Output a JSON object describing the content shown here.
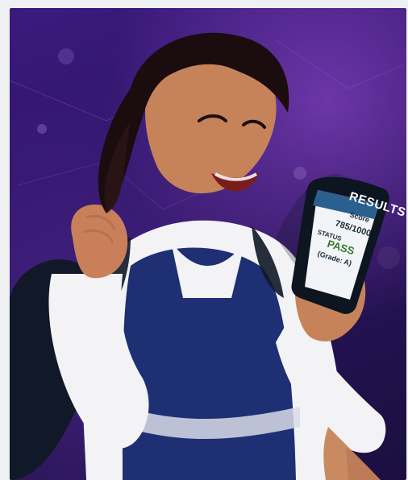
{
  "phone_screen": {
    "header": "RESULTS",
    "score_label": "Score",
    "score_value": "785/1000",
    "status_label": "STATUS",
    "status_value": "PASS",
    "grade": "(Grade: A)"
  },
  "colors": {
    "background_top": "#3b1a7e",
    "background_bottom": "#1b0f3f",
    "uniform_blue": "#1e2f74",
    "shirt_white": "#f3f3f6",
    "phone_header_blue": "#2b5f8f"
  }
}
